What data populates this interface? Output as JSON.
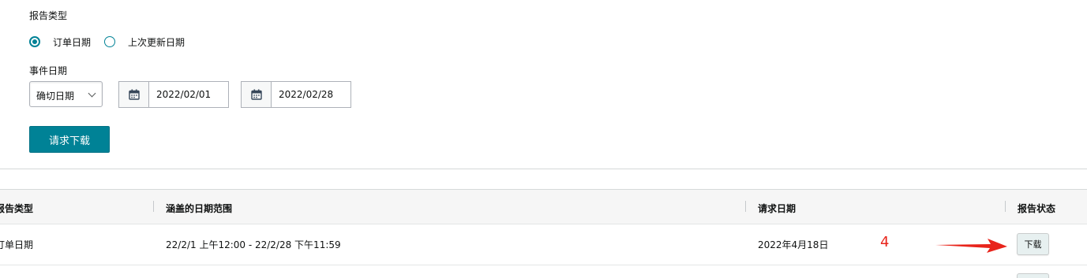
{
  "form": {
    "report_type_label": "报告类型",
    "report_type_options": [
      {
        "label": "订单日期",
        "checked": true
      },
      {
        "label": "上次更新日期",
        "checked": false
      }
    ],
    "event_date_label": "事件日期",
    "date_mode_select": {
      "value": "确切日期"
    },
    "start_date": "2022/02/01",
    "end_date": "2022/02/28",
    "request_button": "请求下载"
  },
  "table": {
    "headers": [
      "报告类型",
      "涵盖的日期范围",
      "请求日期",
      "报告状态"
    ],
    "rows": [
      {
        "report_type": "订单日期",
        "date_range": "22/2/1 上午12:00 - 22/2/28 下午11:59",
        "request_date": "2022年4月18日",
        "status_button": "下载"
      }
    ]
  },
  "annotation": {
    "number": "4",
    "color": "#e8241b"
  },
  "colors": {
    "accent": "#008296",
    "border": "#adb1b8",
    "header_bg": "#f6f6f6"
  },
  "icons": [
    "calendar-icon",
    "chevron-down-icon",
    "arrow-annotation"
  ]
}
